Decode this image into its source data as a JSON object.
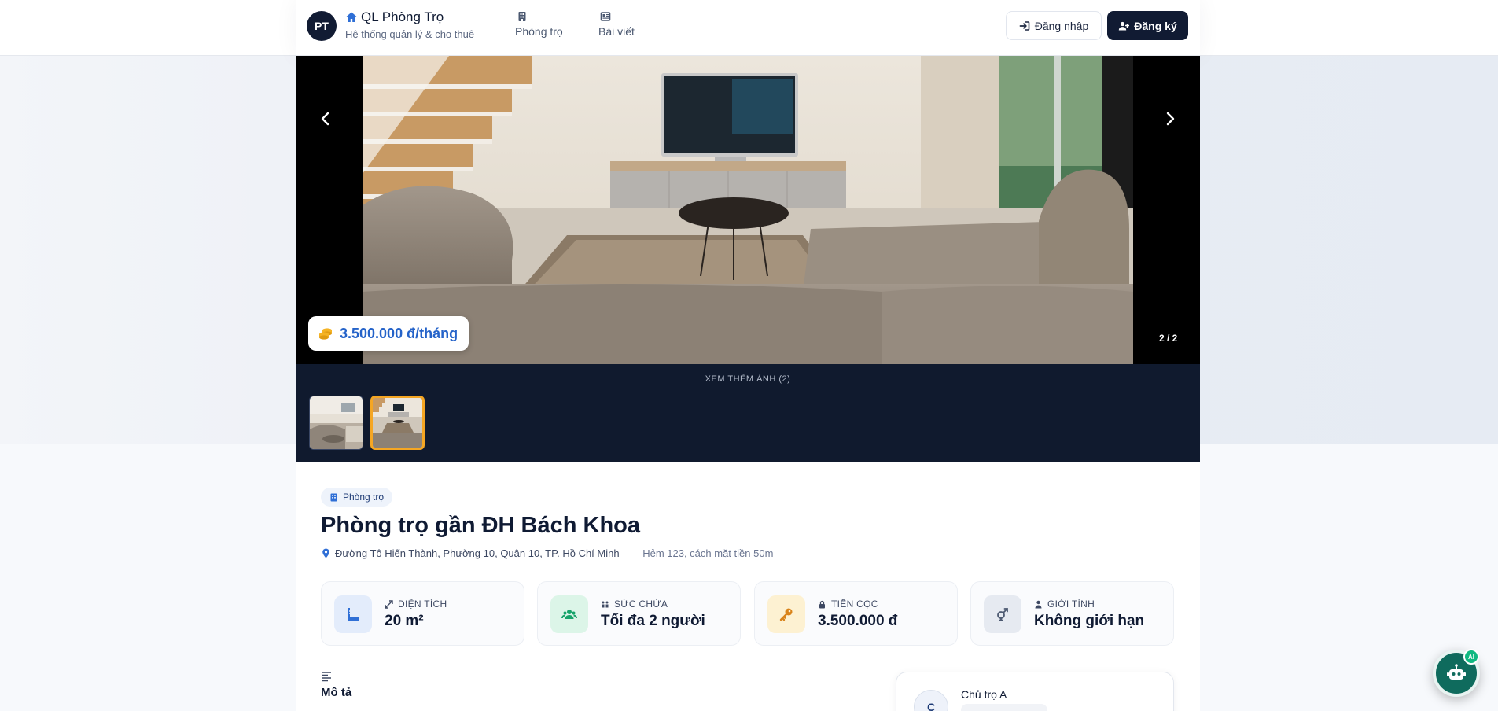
{
  "header": {
    "avatar_initials": "PT",
    "brand_title": "QL Phòng Trọ",
    "brand_subtitle": "Hệ thống quản lý & cho thuê",
    "nav": [
      {
        "label": "Phòng trọ",
        "icon": "building-icon"
      },
      {
        "label": "Bài viết",
        "icon": "newspaper-icon"
      }
    ],
    "login_label": "Đăng nhập",
    "register_label": "Đăng ký"
  },
  "gallery": {
    "price": "3.500.000 đ/tháng",
    "counter": "2 / 2",
    "more_photos_label": "XEM THÊM ẢNH (2)",
    "active_index": 2,
    "total": 2
  },
  "listing": {
    "category": "Phòng trọ",
    "title": "Phòng trọ gần ĐH Bách Khoa",
    "address": "Đường Tô Hiến Thành, Phường 10, Quận 10, TP. Hồ Chí Minh",
    "address_extra": "— Hẻm 123, cách mặt tiền 50m",
    "stats": [
      {
        "label": "DIỆN TÍCH",
        "value": "20 m²",
        "icon": "ruler-icon",
        "color": "#e3ecfb"
      },
      {
        "label": "SỨC CHỨA",
        "value": "Tối đa 2 người",
        "icon": "users-icon",
        "color": "#dcf5e8"
      },
      {
        "label": "TIỀN CỌC",
        "value": "3.500.000 đ",
        "icon": "key-icon",
        "color": "#fdf1d2"
      },
      {
        "label": "GIỚI TÍNH",
        "value": "Không giới hạn",
        "icon": "gender-icon",
        "color": "#e6eaf1"
      }
    ],
    "description_title": "Mô tả"
  },
  "owner": {
    "initial": "C",
    "name": "Chủ trọ A"
  },
  "chatbot": {
    "badge": "AI"
  },
  "colors": {
    "navy": "#111b33",
    "accent_blue": "#2563c9",
    "thumb_active": "#f5a623",
    "chatbot": "#0f6b5d"
  }
}
